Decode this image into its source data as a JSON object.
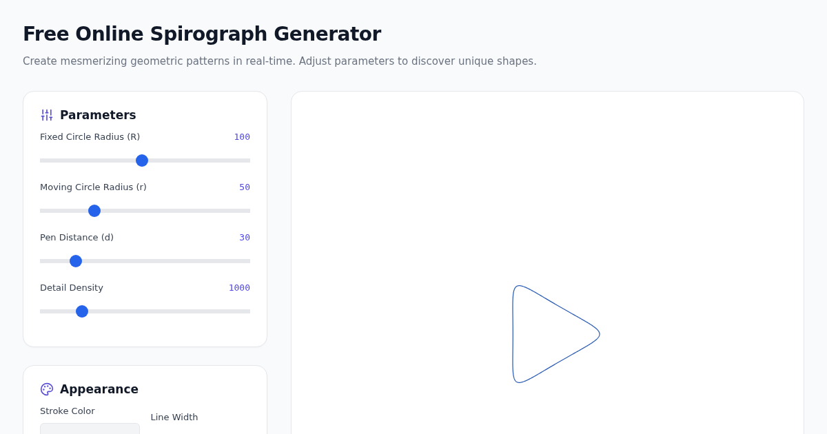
{
  "title": "Free Online Spirograph Generator",
  "subtitle": "Create mesmerizing geometric patterns in real-time. Adjust parameters to discover unique shapes.",
  "parameters": {
    "heading": "Parameters",
    "sliders": [
      {
        "label": "Fixed Circle Radius (R)",
        "reading": "100",
        "level": 0.485
      },
      {
        "label": "Moving Circle Radius (r)",
        "reading": "50",
        "level": 0.26
      },
      {
        "label": "Pen Distance (d)",
        "reading": "30",
        "level": 0.17
      },
      {
        "label": "Detail Density",
        "reading": "1000",
        "level": 0.2
      }
    ]
  },
  "appearance": {
    "heading": "Appearance",
    "stroke_color_label": "Stroke Color",
    "line_width_label": "Line Width"
  }
}
